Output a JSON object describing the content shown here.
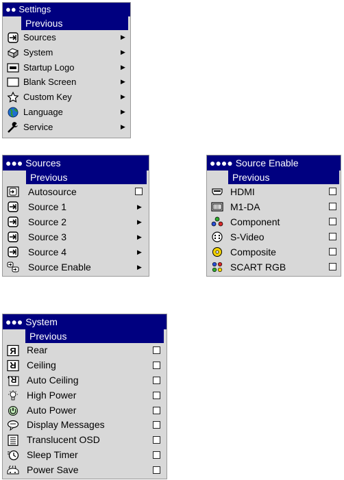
{
  "settings_menu": {
    "title": "●● Settings",
    "previous": "Previous",
    "items": [
      {
        "label": "Sources",
        "icon": "sources-icon"
      },
      {
        "label": "System",
        "icon": "system-icon"
      },
      {
        "label": "Startup Logo",
        "icon": "logo-icon"
      },
      {
        "label": "Blank Screen",
        "icon": "blank-screen-icon"
      },
      {
        "label": "Custom Key",
        "icon": "star-icon"
      },
      {
        "label": "Language",
        "icon": "globe-icon"
      },
      {
        "label": "Service",
        "icon": "wrench-icon"
      }
    ],
    "submenu_arrow": "▶"
  },
  "sources_menu": {
    "title": "●●● Sources",
    "previous": "Previous",
    "items": [
      {
        "label": "Autosource",
        "icon": "autosource-icon",
        "control": "checkbox",
        "checked": false
      },
      {
        "label": "Source 1",
        "icon": "source-icon",
        "control": "arrow"
      },
      {
        "label": "Source 2",
        "icon": "source-icon",
        "control": "arrow"
      },
      {
        "label": "Source 3",
        "icon": "source-icon",
        "control": "arrow"
      },
      {
        "label": "Source 4",
        "icon": "source-icon",
        "control": "arrow"
      },
      {
        "label": "Source Enable",
        "icon": "source-enable-icon",
        "control": "arrow"
      }
    ],
    "submenu_arrow": "▶"
  },
  "source_enable_menu": {
    "title": "●●●● Source Enable",
    "previous": "Previous",
    "items": [
      {
        "label": "HDMI",
        "icon": "hdmi-icon",
        "checked": false
      },
      {
        "label": "M1-DA",
        "icon": "m1-da-icon",
        "checked": false
      },
      {
        "label": "Component",
        "icon": "component-icon",
        "checked": false
      },
      {
        "label": "S-Video",
        "icon": "s-video-icon",
        "checked": false
      },
      {
        "label": "Composite",
        "icon": "composite-icon",
        "checked": false
      },
      {
        "label": "SCART RGB",
        "icon": "scart-rgb-icon",
        "checked": false
      }
    ]
  },
  "system_menu": {
    "title": "●●● System",
    "previous": "Previous",
    "items": [
      {
        "label": "Rear",
        "icon": "rear-icon",
        "checked": false
      },
      {
        "label": "Ceiling",
        "icon": "ceiling-icon",
        "checked": false
      },
      {
        "label": "Auto Ceiling",
        "icon": "auto-ceiling-icon",
        "checked": false
      },
      {
        "label": "High Power",
        "icon": "lightbulb-icon",
        "checked": false
      },
      {
        "label": "Auto Power",
        "icon": "auto-power-icon",
        "checked": false
      },
      {
        "label": "Display Messages",
        "icon": "speech-bubble-icon",
        "checked": false
      },
      {
        "label": "Translucent OSD",
        "icon": "translucent-osd-icon",
        "checked": false
      },
      {
        "label": "Sleep Timer",
        "icon": "clock-icon",
        "checked": false
      },
      {
        "label": "Power Save",
        "icon": "power-save-icon",
        "checked": false
      }
    ]
  },
  "colors": {
    "title_bar": "#000080",
    "menu_background": "#d8d8d8",
    "text": "#000000",
    "highlight_text": "#ffffff"
  }
}
